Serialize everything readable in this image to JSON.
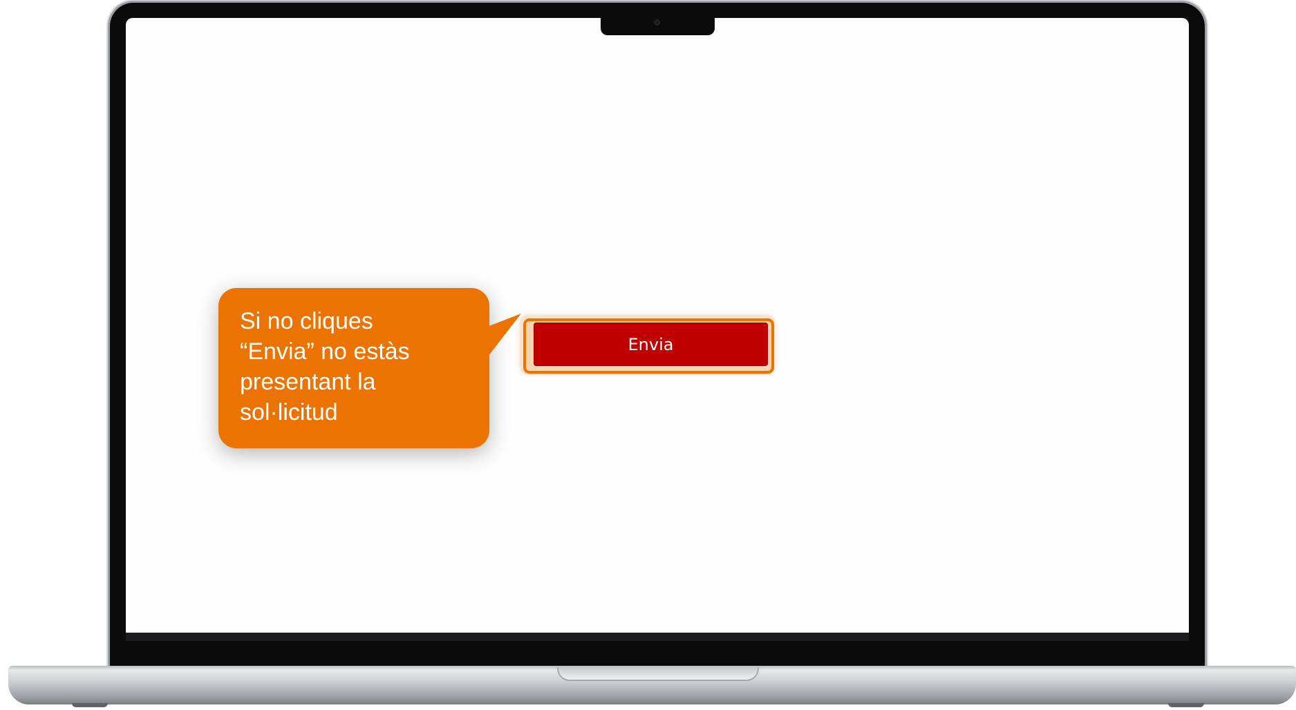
{
  "callout": {
    "lines": [
      "Si no cliques",
      "“Envia” no estàs",
      "presentant la",
      "sol·licitud"
    ]
  },
  "button": {
    "label": "Envia"
  },
  "colors": {
    "callout_background": "#ed7300",
    "button_background": "#c00000",
    "button_highlight": "#ed7300",
    "screen_background": "#fdfdfd"
  }
}
